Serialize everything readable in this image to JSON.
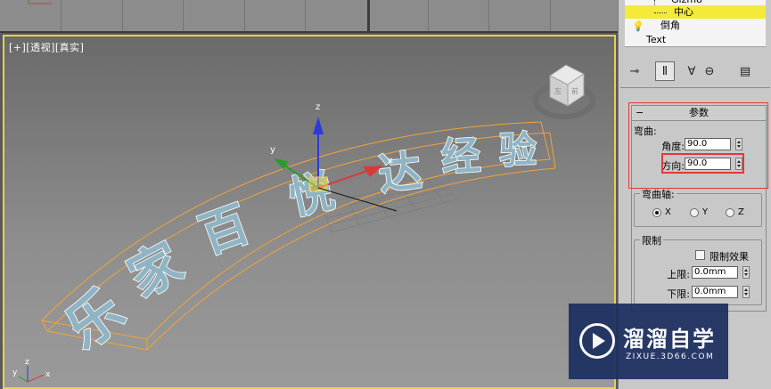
{
  "viewport": {
    "label": "[+][透视][真实]",
    "scene_text": "乐家百悦达经验",
    "gizmo_axes": {
      "x": "x",
      "y": "y",
      "z": "z"
    },
    "corner_axes": {
      "x": "x",
      "y": "y",
      "z": "z"
    },
    "viewcube": {
      "front": "前",
      "left": "左"
    },
    "colors": {
      "border_active": "#e7d24a",
      "bend_cage": "#f2a33a",
      "text_outline": "#ffffff",
      "text_body": "#8fb4c4"
    }
  },
  "modifier_stack": {
    "items": [
      {
        "label": "Gizmo",
        "selected": false
      },
      {
        "label": "中心",
        "selected": true
      },
      {
        "label": "倒角",
        "selected": false
      },
      {
        "label": "Text",
        "selected": false
      }
    ],
    "toolbar": [
      "pin-stack",
      "show-end-result",
      "make-unique",
      "remove-modifier",
      "configure-modifier-sets"
    ]
  },
  "params": {
    "title": "参数",
    "bend_group": "弯曲:",
    "angle_label": "角度:",
    "angle_value": "90.0",
    "direction_label": "方向:",
    "direction_value": "90.0",
    "axis_group": "弯曲轴:",
    "axes": [
      "X",
      "Y",
      "Z"
    ],
    "selected_axis": "X",
    "limit_group": "限制",
    "limit_effect_label": "限制效果",
    "limit_effect_checked": false,
    "upper_label": "上限:",
    "upper_value": "0.0mm",
    "lower_label": "下限:",
    "lower_value": "0.0mm"
  },
  "watermark": {
    "title": "溜溜自学",
    "subtitle": "ZIXUE.3D66.COM"
  }
}
